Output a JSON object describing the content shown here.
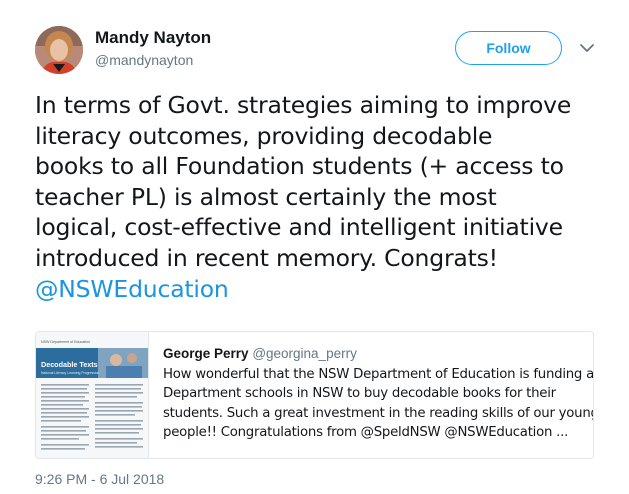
{
  "author": {
    "name": "Mandy Nayton",
    "handle": "@mandynayton"
  },
  "follow_label": "Follow",
  "tweet": {
    "lines": [
      "In terms of Govt. strategies aiming to improve",
      "literacy outcomes, providing decodable",
      "books to all Foundation students (+ access to",
      "teacher PL) is almost certainly the most",
      "logical, cost-effective and intelligent initiative",
      "introduced in recent memory. Congrats!"
    ],
    "mention": "@NSWEducation"
  },
  "quoted_tweet": {
    "name": "George Perry",
    "handle": "@georgina_perry",
    "lines": [
      "How wonderful that the NSW Department of Education is funding all",
      "Department schools in NSW to buy decodable books for their",
      "students.  Such a great investment in the reading skills of our young",
      "people!! Congratulations from @SpeldNSW @NSWEducation ..."
    ],
    "thumbnail": {
      "org": "NSW Department of Education",
      "title": "Decodable Texts",
      "subtitle": "National Literacy Learning Progression"
    }
  },
  "timestamp": "9:26 PM - 6 Jul 2018",
  "colors": {
    "accent": "#1da1f2",
    "link": "#1b95e0",
    "muted": "#657786",
    "thumb_banner": "#1f5d8c"
  },
  "icons": {
    "caret": "chevron-down-icon"
  }
}
